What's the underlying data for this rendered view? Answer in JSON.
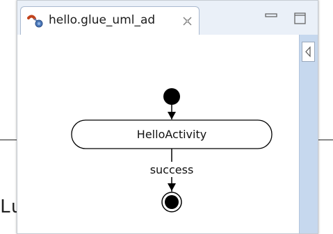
{
  "editor": {
    "tab_title": "hello.glue_uml_ad",
    "tab_icon": "activity-diagram-file-icon",
    "close_icon": "close-icon",
    "minimize_icon": "minimize-icon",
    "maximize_icon": "maximize-icon",
    "scroll_icon": "chevron-left-icon"
  },
  "diagram": {
    "activity_name": "HelloActivity",
    "transition_label": "success",
    "start_node": "initial-node",
    "end_node": "final-node"
  },
  "background": {
    "partial_text": "Lu"
  },
  "colors": {
    "tabbar_bg": "#eaf0f8",
    "scrollbar_bg": "#c6d8ee",
    "node_fill": "#000000"
  }
}
